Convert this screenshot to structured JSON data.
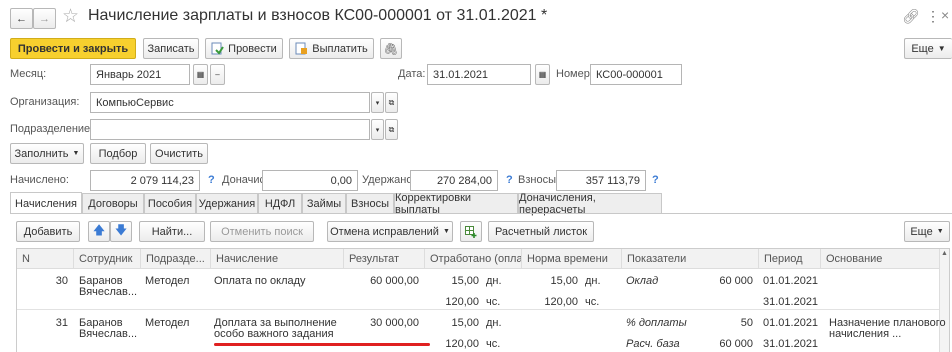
{
  "window": {
    "back_arrow": "←",
    "fwd_arrow": "→",
    "star": "☆",
    "title": "Начисление зарплаты и взносов КС00-000001 от 31.01.2021 *",
    "link_icon": "link-icon",
    "menu_icon": "⋮",
    "close_icon": "×"
  },
  "toolbar": {
    "post_close": "Провести и закрыть",
    "save": "Записать",
    "post": "Провести",
    "pay": "Выплатить",
    "attach_icon": "paperclip-icon",
    "more": "Еще"
  },
  "month": {
    "label": "Месяц:",
    "value": "Январь 2021"
  },
  "date": {
    "label": "Дата:",
    "value": "31.01.2021"
  },
  "number": {
    "label": "Номер:",
    "value": "КС00-000001"
  },
  "org": {
    "label": "Организация:",
    "value": "КомпьюСервис"
  },
  "dept": {
    "label": "Подразделение:",
    "value": ""
  },
  "actions": {
    "fill": "Заполнить",
    "select": "Подбор",
    "clear": "Очистить"
  },
  "totals": {
    "accrued_label": "Начислено:",
    "accrued": "2 079 114,23",
    "q": "?",
    "extra_label": "Доначислено:",
    "extra": "0,00",
    "withheld_label": "Удержано:",
    "withheld": "270 284,00",
    "contrib_label": "Взносы:",
    "contrib": "357 113,79"
  },
  "tabs": [
    "Начисления",
    "Договоры",
    "Пособия",
    "Удержания",
    "НДФЛ",
    "Займы",
    "Взносы",
    "Корректировки выплаты",
    "Доначисления, перерасчеты"
  ],
  "grid_toolbar": {
    "add": "Добавить",
    "find": "Найти...",
    "cancel_search": "Отменить поиск",
    "undo_fix": "Отмена исправлений",
    "payslip": "Расчетный листок",
    "more": "Еще"
  },
  "columns": [
    "N",
    "Сотрудник",
    "Подразде...",
    "Начисление",
    "Результат",
    "Отработано (оплаче...",
    "Норма времени",
    "Показатели",
    "Период",
    "Основание"
  ],
  "rows": [
    {
      "n": "30",
      "emp1": "Баранов",
      "emp2": "Вячеслав...",
      "dept": "Методел",
      "accr1": "Оплата по окладу",
      "accr2": "",
      "result": "60 000,00",
      "w1": "15,00",
      "u1": "дн.",
      "w2": "120,00",
      "u2": "чс.",
      "n1": "15,00",
      "nu1": "дн.",
      "n2": "120,00",
      "nu2": "чс.",
      "ind1": "Оклад",
      "iv1": "60 000",
      "ind2": "",
      "iv2": "",
      "p1": "01.01.2021",
      "p2": "31.01.2021",
      "base1": "",
      "base2": ""
    },
    {
      "n": "31",
      "emp1": "Баранов",
      "emp2": "Вячеслав...",
      "dept": "Методел",
      "accr1": "Доплата за выполнение",
      "accr2": "особо важного задания",
      "result": "30 000,00",
      "w1": "15,00",
      "u1": "дн.",
      "w2": "120,00",
      "u2": "чс.",
      "n1": "",
      "nu1": "",
      "n2": "",
      "nu2": "",
      "ind1": "% доплаты",
      "iv1": "50",
      "ind2": "Расч. база",
      "iv2": "60 000",
      "p1": "01.01.2021",
      "p2": "31.01.2021",
      "base1": "Назначение планового",
      "base2": "начисления ..."
    }
  ],
  "colors": {
    "primary": "#f7d02e",
    "underline": "#e02020",
    "link": "#3b7bd4"
  }
}
